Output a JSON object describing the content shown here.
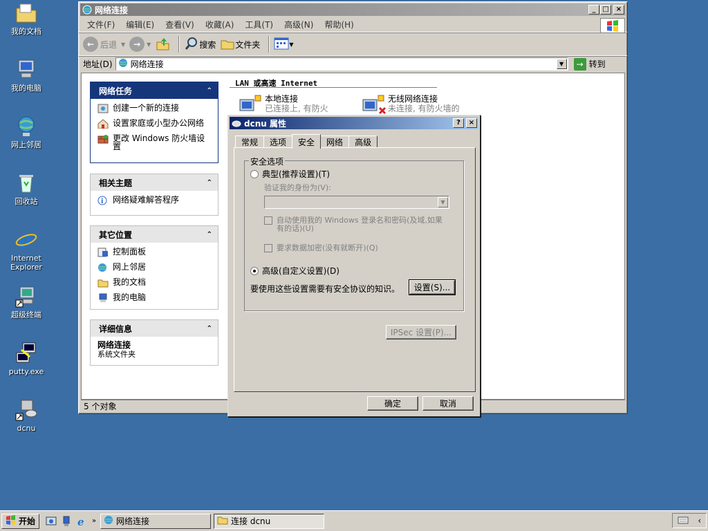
{
  "desktop": {
    "icons": [
      {
        "label": "我的文档"
      },
      {
        "label": "我的电脑"
      },
      {
        "label": "网上邻居"
      },
      {
        "label": "回收站"
      },
      {
        "label": "Internet Explorer"
      },
      {
        "label": "超级终端"
      },
      {
        "label": "putty.exe"
      },
      {
        "label": "dcnu"
      }
    ]
  },
  "explorer": {
    "title": "网络连接",
    "menu": [
      "文件(F)",
      "编辑(E)",
      "查看(V)",
      "收藏(A)",
      "工具(T)",
      "高级(N)",
      "帮助(H)"
    ],
    "toolbar": {
      "back": "后退",
      "search": "搜索",
      "folders": "文件夹"
    },
    "address": {
      "label": "地址(D)",
      "value": "网络连接",
      "go": "转到"
    },
    "panels": {
      "tasks": {
        "title": "网络任务",
        "items": [
          "创建一个新的连接",
          "设置家庭或小型办公网络",
          "更改 Windows 防火墙设置"
        ]
      },
      "related": {
        "title": "相关主题",
        "items": [
          "网络疑难解答程序"
        ]
      },
      "other": {
        "title": "其它位置",
        "items": [
          "控制面板",
          "网上邻居",
          "我的文档",
          "我的电脑"
        ]
      },
      "details": {
        "title": "详细信息",
        "name": "网络连接",
        "type": "系统文件夹"
      }
    },
    "group_header": "LAN 或高速 Internet",
    "connections": [
      {
        "name": "本地连接",
        "status": "已连接上, 有防火"
      },
      {
        "name": "无线网络连接",
        "status": "未连接, 有防火墙的"
      }
    ],
    "status": "5 个对象"
  },
  "dialog": {
    "title": "dcnu 属性",
    "tabs": [
      "常规",
      "选项",
      "安全",
      "网络",
      "高级"
    ],
    "active_tab": "安全",
    "fieldset_label": "安全选项",
    "typical_label": "典型(推荐设置)(T)",
    "verify_label": "验证我的身份为(V):",
    "auto_use_label": "自动使用我的 Windows 登录名和密码(及域,如果有的话)(U)",
    "require_encrypt_label": "要求数据加密(没有就断开)(Q)",
    "advanced_label": "高级(自定义设置)(D)",
    "advanced_hint": "要使用这些设置需要有安全协议的知识。",
    "settings_button": "设置(S)...",
    "ipsec_button": "IPSec 设置(P)...",
    "ok": "确定",
    "cancel": "取消"
  },
  "taskbar": {
    "start": "开始",
    "tasks": [
      "网络连接",
      "连接 dcnu"
    ]
  }
}
